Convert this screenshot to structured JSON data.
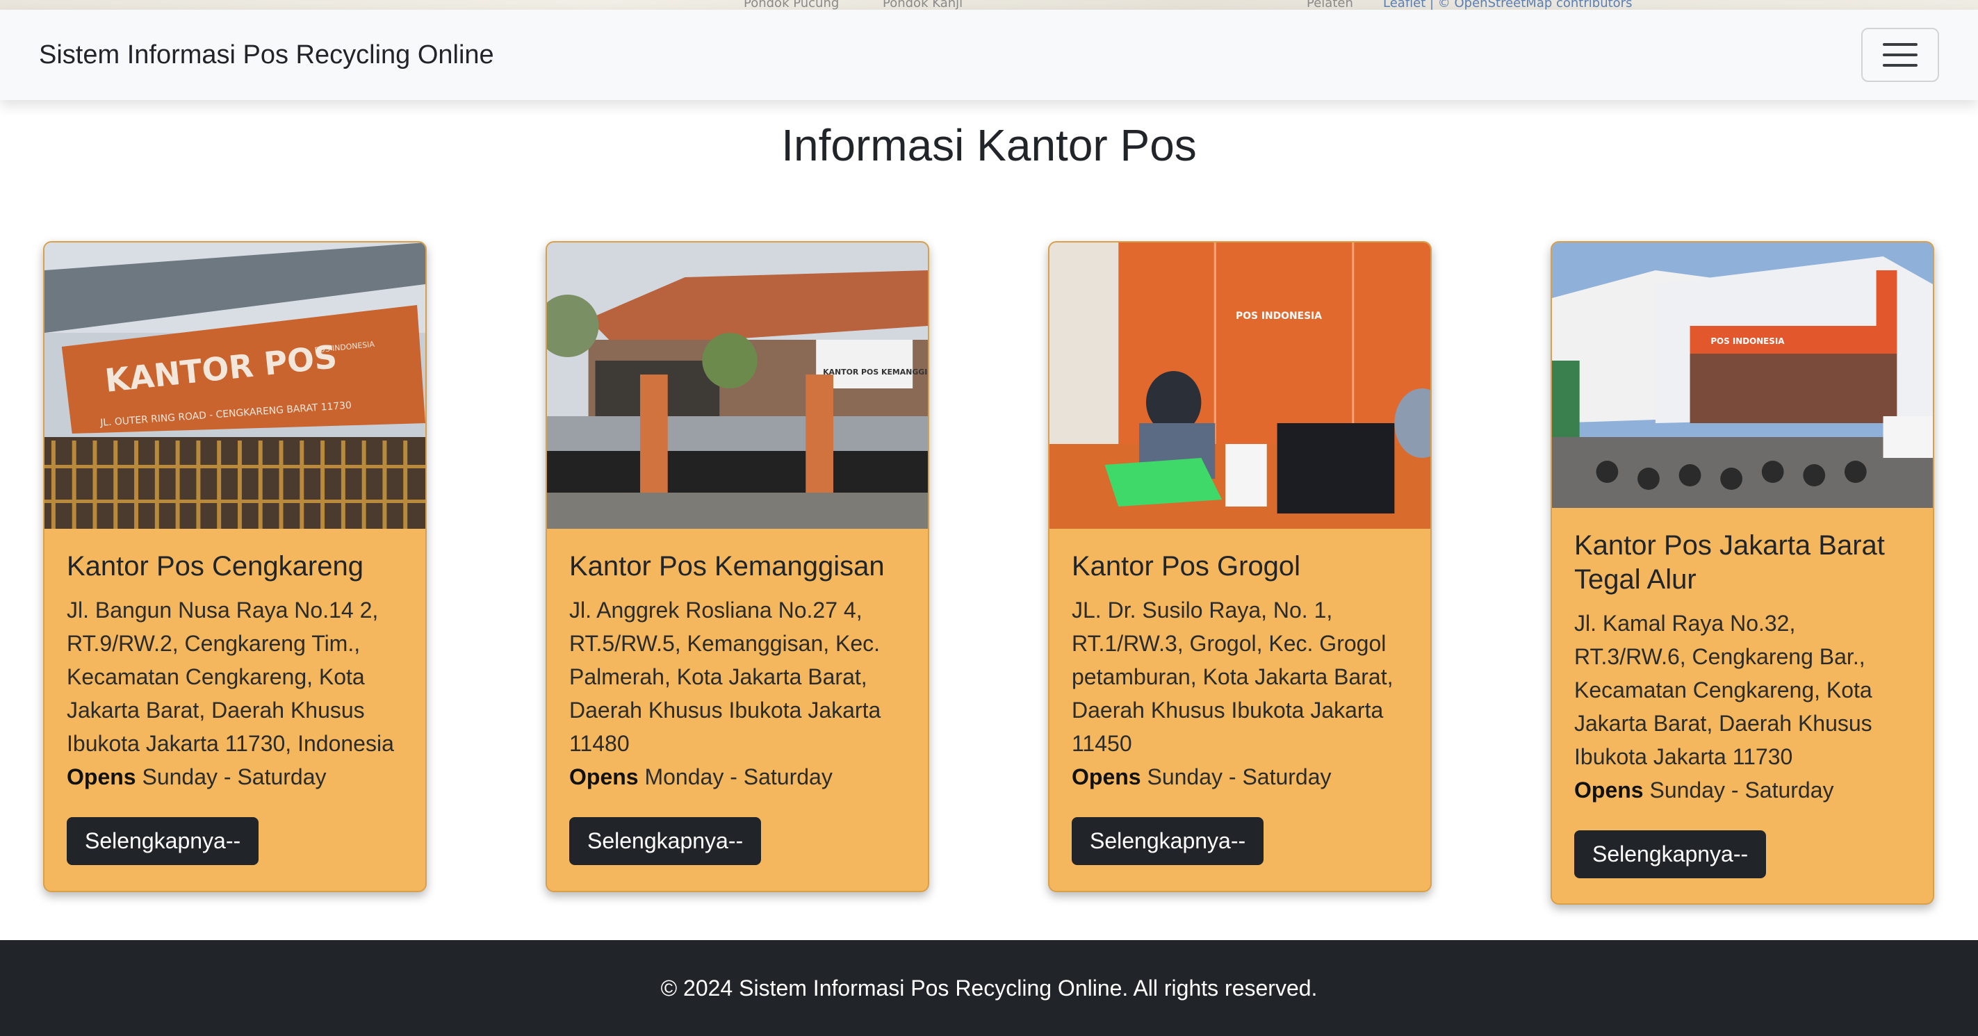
{
  "map_attribution": {
    "places": [
      "Pondok Pucung",
      "Pondok Kanji",
      "Pelaten"
    ],
    "credit": "Leaflet | © OpenStreetMap contributors"
  },
  "navbar": {
    "brand": "Sistem Informasi Pos Recycling Online",
    "toggler_icon": "hamburger-menu-icon"
  },
  "page": {
    "title": "Informasi Kantor Pos"
  },
  "offices": [
    {
      "name": "Kantor Pos Cengkareng",
      "address": "Jl. Bangun Nusa Raya No.14 2, RT.9/RW.2, Cengkareng Tim., Kecamatan Cengkareng, Kota Jakarta Barat, Daerah Khusus Ibukota Jakarta 11730, Indonesia",
      "opens_label": "Opens",
      "opens_days": "Sunday - Saturday",
      "button": "Selengkapnya--",
      "photo_sign_text": "KANTOR POS",
      "photo_sign_sub": "JL. OUTER RING ROAD - CENGKARENG BARAT 11730",
      "photo_logo_text": "POS INDONESIA"
    },
    {
      "name": "Kantor Pos Kemanggisan",
      "address": "Jl. Anggrek Rosliana No.27 4, RT.5/RW.5, Kemanggisan, Kec. Palmerah, Kota Jakarta Barat, Daerah Khusus Ibukota Jakarta 11480",
      "opens_label": "Opens",
      "opens_days": "Monday - Saturday",
      "button": "Selengkapnya--",
      "photo_sign_text": "KANTOR POS KEMANGGISAN"
    },
    {
      "name": "Kantor Pos Grogol",
      "address": "JL. Dr. Susilo Raya, No. 1, RT.1/RW.3, Grogol, Kec. Grogol petamburan, Kota Jakarta Barat, Daerah Khusus Ibukota Jakarta 11450",
      "opens_label": "Opens",
      "opens_days": "Sunday - Saturday",
      "button": "Selengkapnya--",
      "photo_logo_text": "POS INDONESIA"
    },
    {
      "name": "Kantor Pos Jakarta Barat Tegal Alur",
      "address": "Jl. Kamal Raya No.32, RT.3/RW.6, Cengkareng Bar., Kecamatan Cengkareng, Kota Jakarta Barat, Daerah Khusus Ibukota Jakarta 11730",
      "opens_label": "Opens",
      "opens_days": "Sunday - Saturday",
      "button": "Selengkapnya--",
      "photo_logo_text": "POS INDONESIA"
    }
  ],
  "footer": {
    "text": "© 2024 Sistem Informasi Pos Recycling Online. All rights reserved."
  },
  "colors": {
    "card_bg": "#f4b75e",
    "button_bg": "#212529",
    "footer_bg": "#212529",
    "navbar_bg": "#f8f9fa"
  }
}
